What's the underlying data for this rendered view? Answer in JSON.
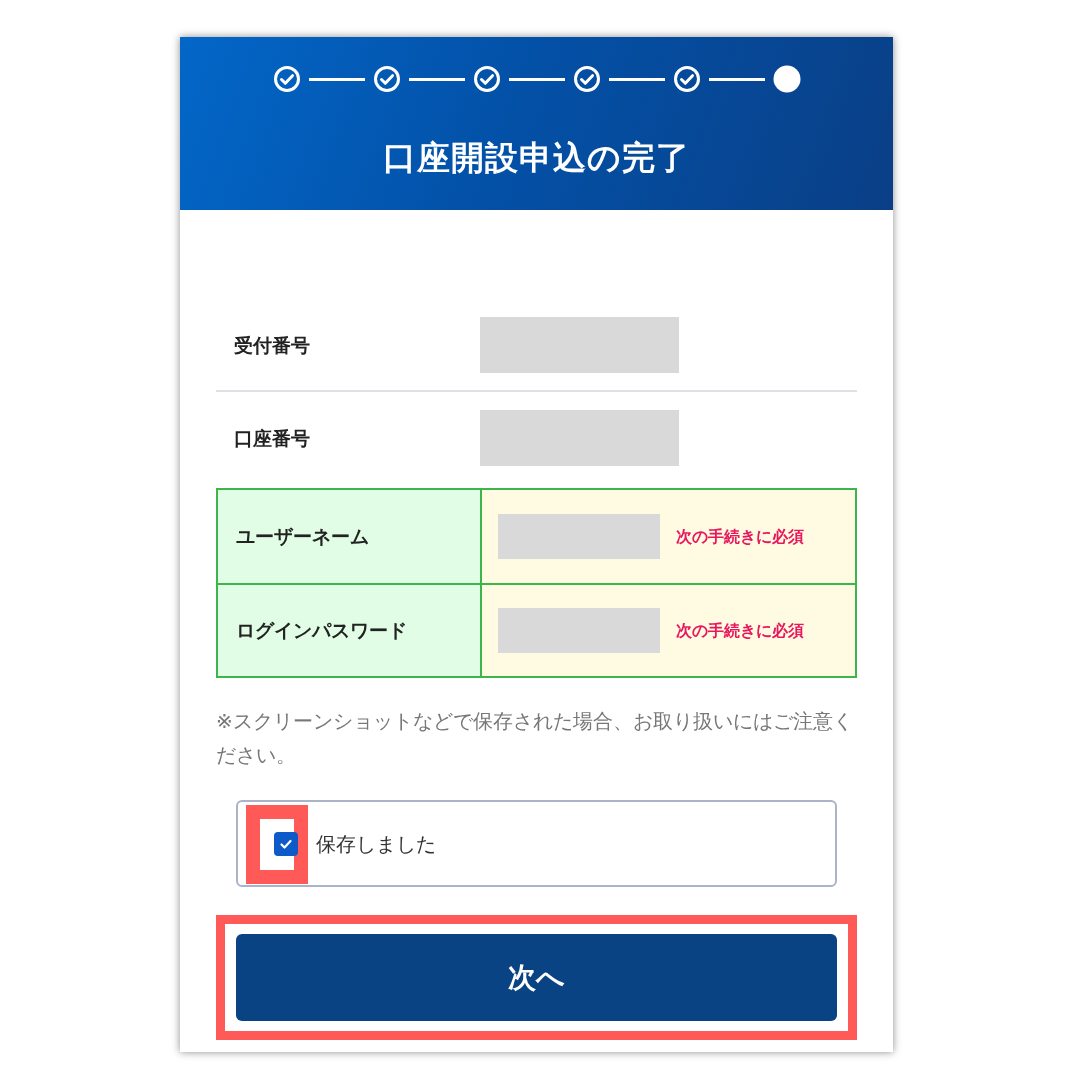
{
  "steps": [
    {
      "done": true
    },
    {
      "done": true
    },
    {
      "done": true
    },
    {
      "done": true
    },
    {
      "done": true
    },
    {
      "done": false
    }
  ],
  "title": "口座開設申込の完了",
  "info_rows": [
    {
      "label": "受付番号"
    },
    {
      "label": "口座番号"
    }
  ],
  "credential_rows": [
    {
      "label": "ユーザーネーム",
      "note": "次の手続きに必須"
    },
    {
      "label": "ログインパスワード",
      "note": "次の手続きに必須"
    }
  ],
  "notice": "※スクリーンショットなどで保存された場合、お取り扱いにはご注意ください。",
  "confirm": {
    "label": "保存しました",
    "checked": true,
    "highlighted": true
  },
  "next_button": {
    "label": "次へ",
    "highlighted": true
  }
}
